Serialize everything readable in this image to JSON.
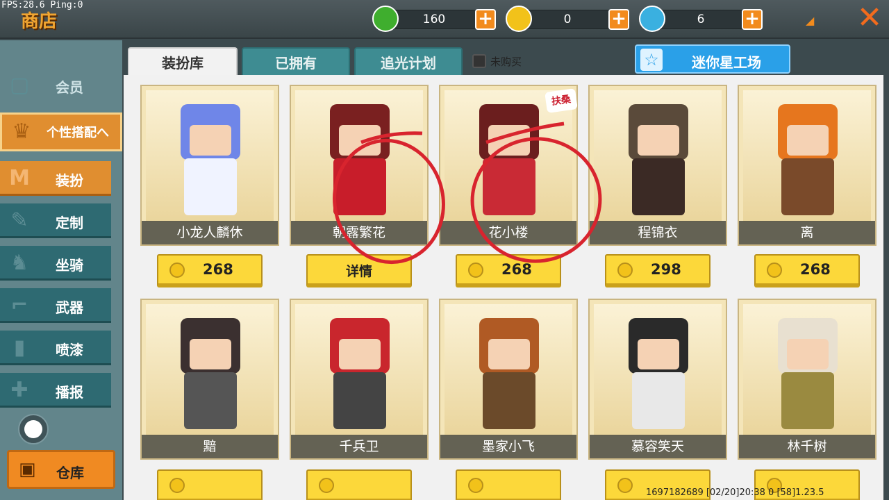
{
  "hud": {
    "fps_text": "FPS:28.6  Ping:0"
  },
  "header": {
    "title": "商店"
  },
  "currencies": [
    {
      "name": "gem",
      "value": "160",
      "color": "#3fae2e",
      "icon": "green-gem-icon"
    },
    {
      "name": "coin",
      "value": "0",
      "color": "#f2c21a",
      "icon": "gold-coin-icon"
    },
    {
      "name": "mini-coin",
      "value": "6",
      "color": "#3ab0e0",
      "icon": "blue-m-coin-icon"
    }
  ],
  "plus_symbol": "+",
  "close_symbol": "✕",
  "sidebar": {
    "items": [
      {
        "label": "会员",
        "icon": "vip-icon"
      },
      {
        "label": "个性搭配へ",
        "icon": "trophy-icon"
      },
      {
        "label": "装扮",
        "icon": "shirt-icon"
      },
      {
        "label": "定制",
        "icon": "brush-icon"
      },
      {
        "label": "坐骑",
        "icon": "mount-icon"
      },
      {
        "label": "武器",
        "icon": "gun-icon"
      },
      {
        "label": "喷漆",
        "icon": "spray-icon"
      },
      {
        "label": "播报",
        "icon": "broadcast-icon"
      }
    ],
    "warehouse": "仓库"
  },
  "tabs": [
    {
      "label": "装扮库",
      "active": true
    },
    {
      "label": "已拥有",
      "active": false
    },
    {
      "label": "追光计划",
      "active": false
    }
  ],
  "filter": {
    "label": "未购买",
    "checked": false
  },
  "workshop": {
    "label": "迷你星工场"
  },
  "limited_tag": "扶桑",
  "skins": [
    {
      "name": "小龙人麟休",
      "price": "268",
      "button": "price",
      "hair": "#6f86e8",
      "outfit": "#f0f3ff"
    },
    {
      "name": "朝露繁花",
      "price": "详情",
      "button": "detail",
      "hair": "#7a2020",
      "outfit": "#c81d2a"
    },
    {
      "name": "花小楼",
      "price": "268",
      "button": "price",
      "hair": "#6b1e1e",
      "outfit": "#c92a35"
    },
    {
      "name": "程锦衣",
      "price": "298",
      "button": "price",
      "hair": "#5a4a3a",
      "outfit": "#3b2a25"
    },
    {
      "name": "离",
      "price": "268",
      "button": "price",
      "hair": "#e6761e",
      "outfit": "#7a4a2a"
    },
    {
      "name": "黯",
      "price": "",
      "button": "price",
      "hair": "#3b3030",
      "outfit": "#555"
    },
    {
      "name": "千兵卫",
      "price": "",
      "button": "price",
      "hair": "#c9262d",
      "outfit": "#444"
    },
    {
      "name": "墨家小飞",
      "price": "",
      "button": "price",
      "hair": "#b05a24",
      "outfit": "#6b4a2a"
    },
    {
      "name": "慕容笑天",
      "price": "",
      "button": "price",
      "hair": "#2a2a2a",
      "outfit": "#e8e8e8"
    },
    {
      "name": "林千树",
      "price": "",
      "button": "price",
      "hair": "#e8e0d0",
      "outfit": "#9a8a40"
    }
  ],
  "footer": {
    "text": "1697182689   [02/20]20:38 0  [58]1.23.5"
  }
}
